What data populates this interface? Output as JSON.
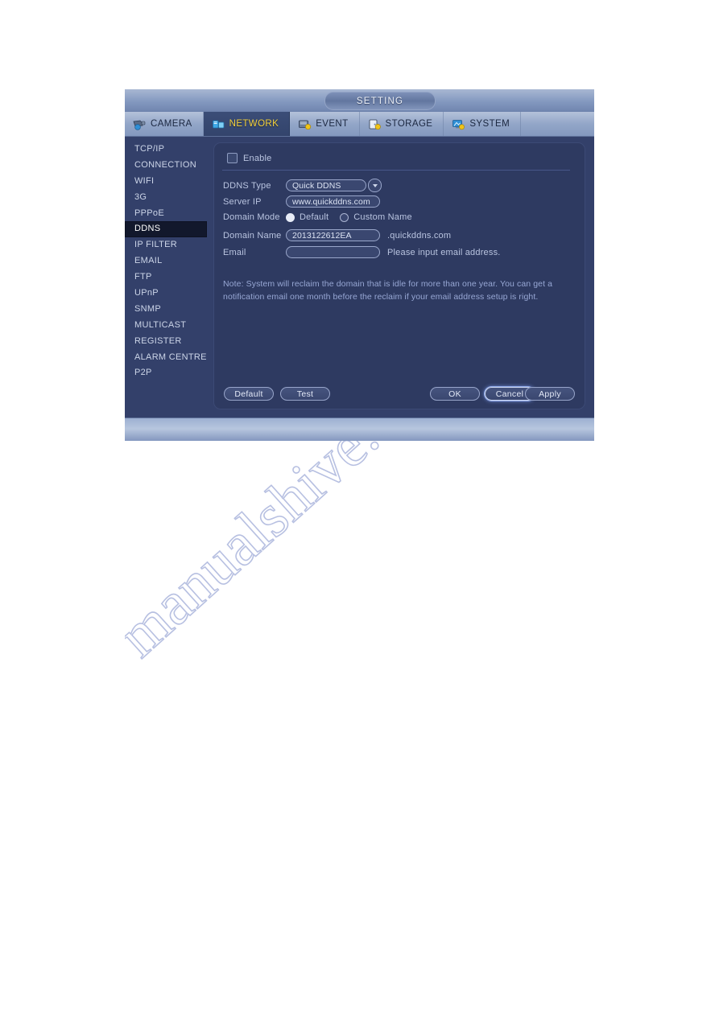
{
  "window": {
    "title": "SETTING"
  },
  "tabs": [
    {
      "label": "CAMERA",
      "icon": "camera-icon",
      "active": false
    },
    {
      "label": "NETWORK",
      "icon": "network-icon",
      "active": true
    },
    {
      "label": "EVENT",
      "icon": "event-icon",
      "active": false
    },
    {
      "label": "STORAGE",
      "icon": "storage-icon",
      "active": false
    },
    {
      "label": "SYSTEM",
      "icon": "system-icon",
      "active": false
    }
  ],
  "sidebar": {
    "items": [
      {
        "label": "TCP/IP",
        "active": false
      },
      {
        "label": "CONNECTION",
        "active": false
      },
      {
        "label": "WIFI",
        "active": false
      },
      {
        "label": "3G",
        "active": false
      },
      {
        "label": "PPPoE",
        "active": false
      },
      {
        "label": "DDNS",
        "active": true
      },
      {
        "label": "IP FILTER",
        "active": false
      },
      {
        "label": "EMAIL",
        "active": false
      },
      {
        "label": "FTP",
        "active": false
      },
      {
        "label": "UPnP",
        "active": false
      },
      {
        "label": "SNMP",
        "active": false
      },
      {
        "label": "MULTICAST",
        "active": false
      },
      {
        "label": "REGISTER",
        "active": false
      },
      {
        "label": "ALARM CENTRE",
        "active": false
      },
      {
        "label": "P2P",
        "active": false
      }
    ]
  },
  "form": {
    "enable": {
      "label": "Enable",
      "checked": false
    },
    "ddns_type": {
      "label": "DDNS Type",
      "value": "Quick DDNS"
    },
    "server_ip": {
      "label": "Server IP",
      "value": "www.quickddns.com"
    },
    "domain_mode": {
      "label": "Domain Mode",
      "options": [
        {
          "label": "Default",
          "selected": true
        },
        {
          "label": "Custom Name",
          "selected": false
        }
      ]
    },
    "domain_name": {
      "label": "Domain Name",
      "value": "2013122612EA",
      "suffix": ".quickddns.com"
    },
    "email": {
      "label": "Email",
      "value": "",
      "placeholder": "",
      "hint": "Please input email address."
    },
    "note": "Note: System will reclaim the domain that is idle for more than one year. You can get a notification email one month before the reclaim if your email address setup is right."
  },
  "buttons": {
    "default": "Default",
    "test": "Test",
    "ok": "OK",
    "cancel": "Cancel",
    "apply": "Apply"
  },
  "watermark": {
    "text": "manualshive.com"
  },
  "colors": {
    "accent_active_tab_text": "#f5d23c",
    "window_chrome": "#8499c0",
    "panel_bg": "#2e3a61",
    "sidebar_bg": "#33406a",
    "sidebar_active_bg": "#12182c",
    "label_text": "#b9c4e0",
    "note_text": "#97a7d4"
  }
}
